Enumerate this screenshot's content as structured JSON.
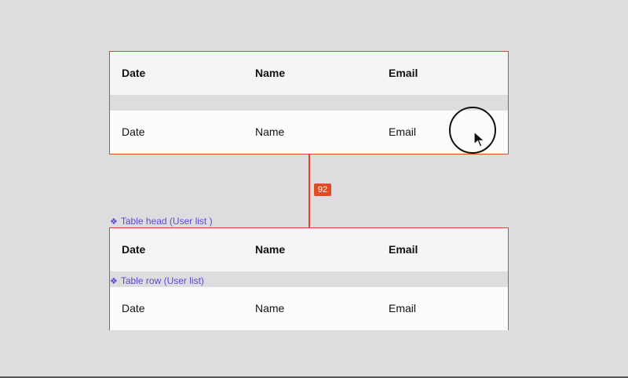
{
  "top_table": {
    "head": [
      "Date",
      "Name",
      "Email"
    ],
    "row": [
      "Date",
      "Name",
      "Email"
    ]
  },
  "spacing_badge": "92",
  "labels": {
    "table_head": "Table head (User list )",
    "table_row": "Table row (User list)"
  },
  "bottom_table": {
    "head": [
      "Date",
      "Name",
      "Email"
    ],
    "row": [
      "Date",
      "Name",
      "Email"
    ]
  },
  "colors": {
    "selection": "#d9482b",
    "component_label": "#5b49d6",
    "canvas": "#dedcde"
  },
  "icons": {
    "component": "component-icon",
    "cursor": "cursor-icon"
  }
}
